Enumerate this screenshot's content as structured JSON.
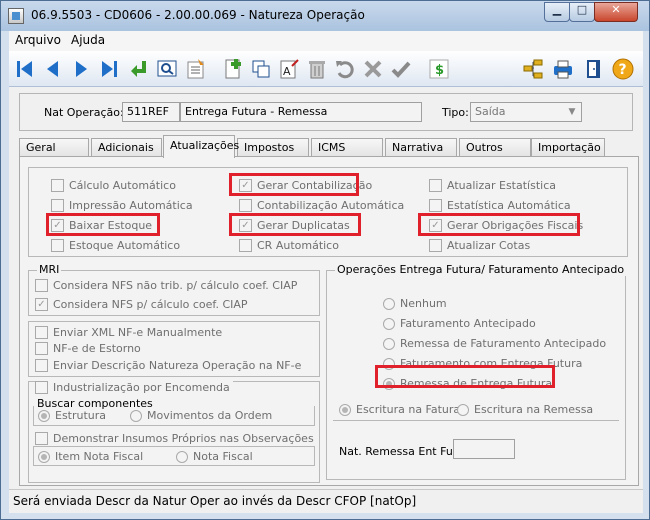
{
  "window": {
    "title": "06.9.5503 - CD0606 - 2.00.00.069 - Natureza Operação"
  },
  "menu": {
    "arquivo": "Arquivo",
    "ajuda": "Ajuda"
  },
  "header": {
    "nat_label": "Nat Operação:",
    "nat_code": "511REF",
    "nat_desc": "Entrega Futura - Remessa",
    "tipo_label": "Tipo:",
    "tipo_value": "Saída"
  },
  "tabs": [
    "Geral",
    "Adicionais",
    "Atualizações",
    "Impostos",
    "ICMS",
    "Narrativa",
    "Outros",
    "Importação"
  ],
  "top_checks": {
    "calculo_automatico": "Cálculo Automático",
    "impressao_automatica": "Impressão Automática",
    "baixar_estoque": "Baixar Estoque",
    "estoque_automatico": "Estoque Automático",
    "gerar_contabilizacao": "Gerar Contabilização",
    "contabilizacao_automatica": "Contabilização Automática",
    "gerar_duplicatas": "Gerar Duplicatas",
    "cr_automatico": "CR Automático",
    "atualizar_estatistica": "Atualizar Estatística",
    "estatistica_automatica": "Estatística Automática",
    "gerar_obrigacoes_fiscais": "Gerar Obrigações Fiscais",
    "atualizar_cotas": "Atualizar Cotas"
  },
  "mri": {
    "title": "MRI",
    "nfs_nao_trib": "Considera NFS não trib. p/ cálculo coef. CIAP",
    "nfs_calc": "Considera NFS p/ cálculo coef. CIAP"
  },
  "nfe": {
    "enviar_xml": "Enviar XML NF-e Manualmente",
    "nf_estorno": "NF-e de Estorno",
    "enviar_descricao": "Enviar Descrição Natureza Operação na NF-e"
  },
  "industrializacao": {
    "title": "Industrialização por Encomenda",
    "buscar_title": "Buscar componentes",
    "estrutura": "Estrutura",
    "movimentos": "Movimentos da Ordem",
    "demonstrar": "Demonstrar Insumos Próprios nas Observações",
    "item_nf": "Item Nota Fiscal",
    "nota_fiscal": "Nota Fiscal"
  },
  "entrega_futura": {
    "title": "Operações Entrega Futura/ Faturamento Antecipado",
    "nenhum": "Nenhum",
    "faturamento_antecipado": "Faturamento Antecipado",
    "remessa_faturamento": "Remessa de Faturamento Antecipado",
    "faturamento_entrega": "Faturamento com Entrega Futura",
    "remessa_entrega": "Remessa de Entrega Futura",
    "escrituracao_fatura": "Escritura na Fatura",
    "escrituracao_remessa": "Escritura na Remessa",
    "nat_remessa_label": "Nat. Remessa Ent Fut:"
  },
  "status": {
    "text": "Será enviada Descr da Natur Oper ao invés da Descr CFOP [natOp]"
  },
  "colors": {
    "highlight": "#e0212b",
    "toolbar_blue": "#1f6fc9"
  }
}
